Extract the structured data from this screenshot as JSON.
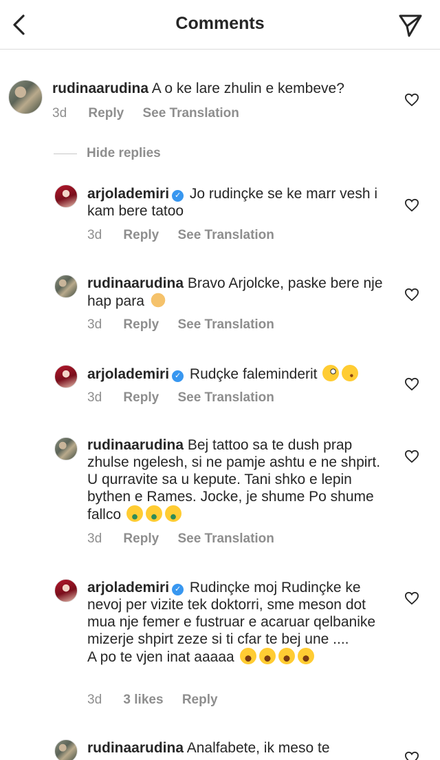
{
  "header": {
    "title": "Comments",
    "back_icon": "chevron-left-icon",
    "send_icon": "paper-plane-icon"
  },
  "hide_replies_label": "Hide replies",
  "actions": {
    "reply": "Reply",
    "see_translation": "See Translation"
  },
  "comments": [
    {
      "user": "rudinaarudina",
      "verified": false,
      "text": "A o ke lare zhulin e kembeve?",
      "time": "3d",
      "likes": ""
    },
    {
      "user": "arjolademiri",
      "verified": true,
      "text": "Jo rudinçke se ke marr vesh i kam bere tatoo",
      "time": "3d",
      "likes": ""
    },
    {
      "user": "rudinaarudina",
      "verified": false,
      "text": "Bravo Arjolcke, paske bere nje hap para",
      "time": "3d",
      "likes": ""
    },
    {
      "user": "arjolademiri",
      "verified": true,
      "text": "Rudçke faleminderit",
      "time": "3d",
      "likes": ""
    },
    {
      "user": "rudinaarudina",
      "verified": false,
      "text": "Bej tattoo sa te dush prap zhulse ngelesh, si ne pamje ashtu e ne shpirt. U qurravite sa u kepute. Tani shko e lepin bythen e Rames. Jocke, je shume Po shume fallco",
      "time": "3d",
      "likes": ""
    },
    {
      "user": "arjolademiri",
      "verified": true,
      "text": "Rudinçke moj Rudinçke ke nevoj per vizite  tek doktorri, sme meson dot mua nje femer e fustruar e acaruar qelbanike mizerje shpirt zeze si ti cfar te bej une ....",
      "text2": "A po te vjen inat aaaaa",
      "time": "3d",
      "likes": "3 likes"
    },
    {
      "user": "rudinaarudina",
      "verified": false,
      "text": "Analfabete, ik meso te",
      "time": "",
      "likes": ""
    }
  ],
  "colors": {
    "text": "#262626",
    "secondary": "#8e8e8e",
    "verified": "#3897f0",
    "divider": "#dbdbdb"
  }
}
